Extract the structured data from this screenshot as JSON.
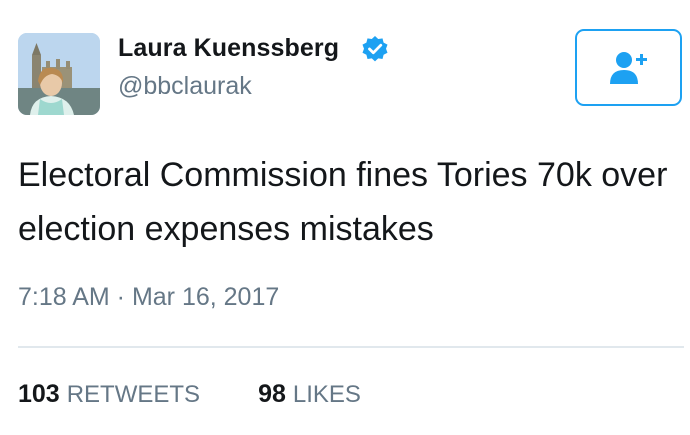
{
  "user": {
    "display_name": "Laura Kuenssberg",
    "handle": "@bbclaurak",
    "verified": true,
    "avatar_icon": "profile-photo"
  },
  "follow_button": {
    "icon": "add-user-icon",
    "color": "#1da1f2"
  },
  "tweet": {
    "text": "Electoral Commission fines Tories 70k over election expenses mistakes",
    "timestamp": "7:18 AM · Mar 16, 2017"
  },
  "stats": {
    "retweets_count": "103",
    "retweets_label": "RETWEETS",
    "likes_count": "98",
    "likes_label": "LIKES"
  },
  "colors": {
    "accent": "#1da1f2",
    "secondary_text": "#657786",
    "primary_text": "#14171a",
    "divider": "#e1e8ed"
  }
}
